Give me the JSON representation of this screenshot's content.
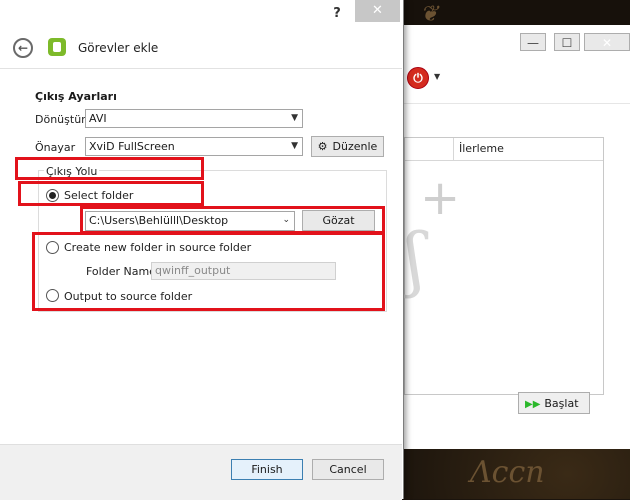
{
  "dialog": {
    "title": "Görevler ekle",
    "help_label": "?",
    "close_label": "✕",
    "section_title": "Çıkış Ayarları",
    "convert_label": "Dönüştür",
    "convert_value": "AVI",
    "preset_label": "Önayar",
    "preset_value": "XviD FullScreen",
    "edit_button": "Düzenle",
    "output_group_title": "Çıkış Yolu",
    "select_folder_label": "Select folder",
    "path_value": "C:\\Users\\Behlülll\\Desktop",
    "browse_button": "Gözat",
    "create_folder_label": "Create new folder in source folder",
    "folder_name_label": "Folder Name",
    "folder_name_value": "qwinff_output",
    "output_source_label": "Output to source folder",
    "finish_button": "Finish",
    "cancel_button": "Cancel"
  },
  "main_window": {
    "minimize_label": "—",
    "maximize_label": "☐",
    "close_label": "✕",
    "progress_column": "İlerleme",
    "start_button": "Başlat"
  },
  "colors": {
    "highlight": "#e2121b",
    "power_red": "#d42b1f",
    "start_green": "#2bb82b"
  },
  "icons": [
    "back-arrow-icon",
    "app-icon",
    "gear-icon",
    "power-icon",
    "chevron-down-icon",
    "play-icon",
    "plus-icon",
    "help-icon",
    "close-icon"
  ]
}
